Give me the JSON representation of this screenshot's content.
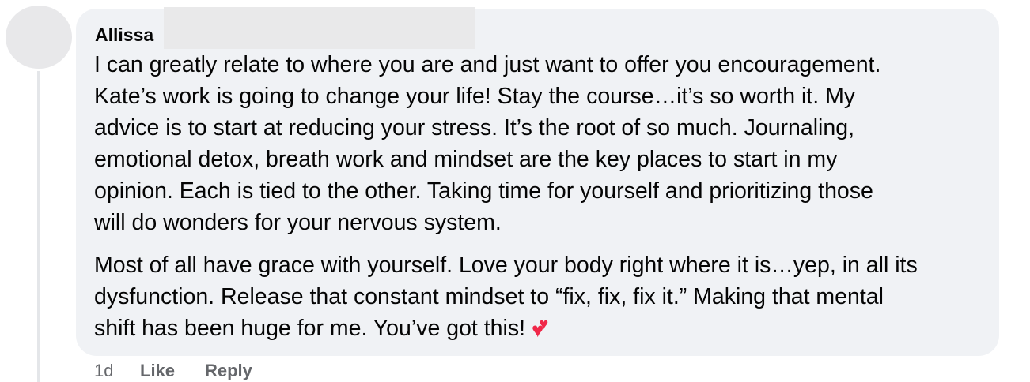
{
  "comment": {
    "author": "Allissa",
    "paragraphs": [
      "I can greatly relate to where you are and just want to offer you encouragement.\nKate’s work is going to change your life! Stay the course…it’s so worth it. My\nadvice is to start at reducing your stress. It’s the root of so much. Journaling,\nemotional detox, breath work and mindset are the key places to start in my\nopinion. Each is tied to the other. Taking time for yourself and prioritizing those\nwill do wonders for your nervous system.",
      "Most of all have grace with yourself. Love your body right where it is…yep, in all its\ndysfunction. Release that constant mindset to “fix, fix, fix it.” Making that mental\nshift has been huge for me. You’ve got this! "
    ],
    "emoji": "two-hearts-emoji",
    "timestamp": "1d",
    "actions": {
      "like_label": "Like",
      "reply_label": "Reply"
    }
  },
  "colors": {
    "bubble": "#f0f2f5",
    "text": "#050505",
    "secondary_text": "#65676b",
    "heart": "#f02849"
  }
}
